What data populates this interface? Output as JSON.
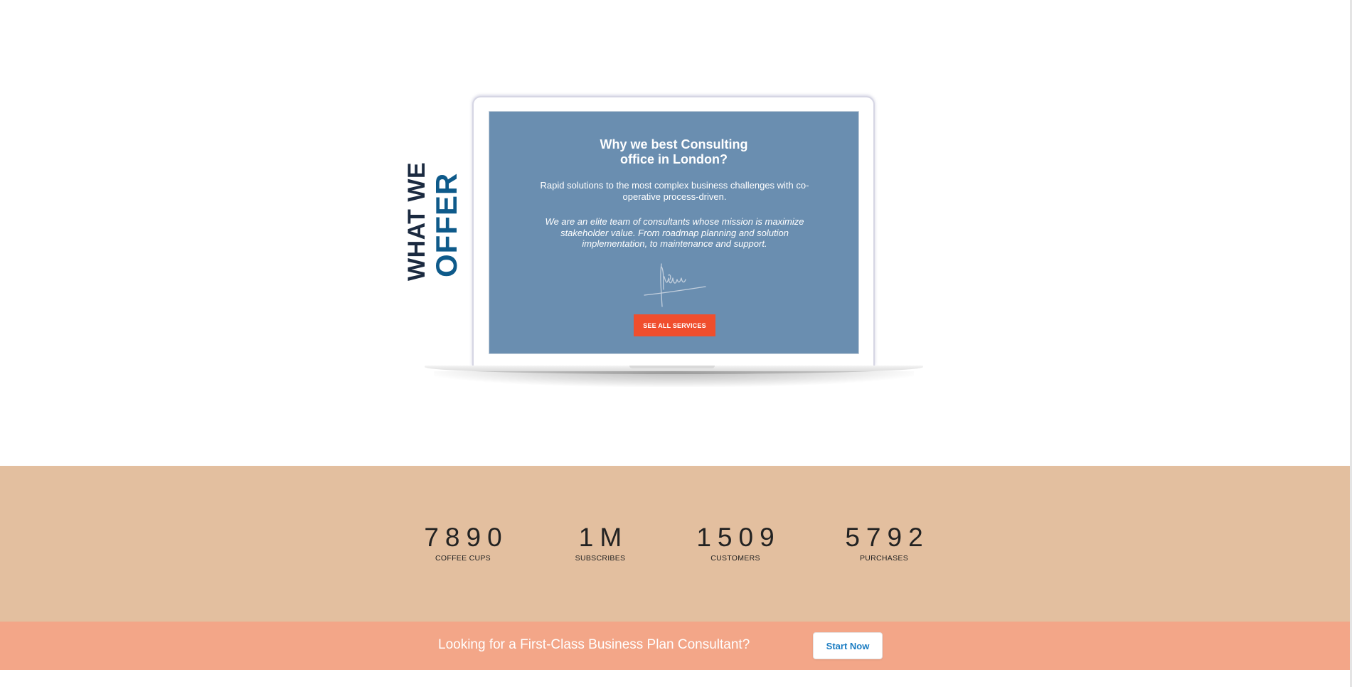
{
  "offer": {
    "heading_line1": "WHAT WE",
    "heading_line2": "OFFER"
  },
  "screen": {
    "title_line1": "Why we best Consulting",
    "title_line2": "office in London?",
    "intro": "Rapid solutions to the most complex business challenges with co-operative process-driven.",
    "body": "We are an elite team of consultants whose mission is maximize stakeholder value. From roadmap planning and solution implementation, to maintenance and support.",
    "button_label": "SEE ALL SERVICES"
  },
  "counters": [
    {
      "value": "7890",
      "label": "COFFEE CUPS"
    },
    {
      "value": "1M",
      "label": "SUBSCRIBES"
    },
    {
      "value": "1509",
      "label": "CUSTOMERS"
    },
    {
      "value": "5792",
      "label": "PURCHASES"
    }
  ],
  "cta": {
    "text": "Looking for a First-Class Business Plan Consultant?",
    "button_label": "Start Now"
  },
  "colors": {
    "screen_bg": "#6a8eb0",
    "button_red": "#f04e2d",
    "counters_bg": "#e3bf9f",
    "cta_bg": "#f3a688",
    "heading_dark": "#1b2a40",
    "heading_blue": "#0e5a8a",
    "link_blue": "#1a7cc2"
  },
  "icons": [
    "signature-image"
  ]
}
